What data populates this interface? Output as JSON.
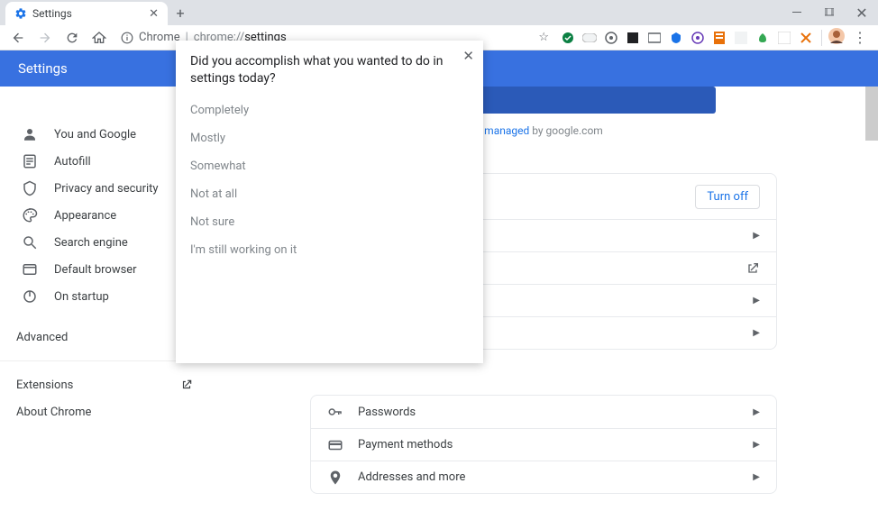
{
  "tab": {
    "title": "Settings"
  },
  "omnibox": {
    "origin": "Chrome",
    "prefix": "chrome://",
    "path": "settings"
  },
  "header": {
    "title": "Settings"
  },
  "sidebar": {
    "items": [
      {
        "label": "You and Google"
      },
      {
        "label": "Autofill"
      },
      {
        "label": "Privacy and security"
      },
      {
        "label": "Appearance"
      },
      {
        "label": "Search engine"
      },
      {
        "label": "Default browser"
      },
      {
        "label": "On startup"
      }
    ],
    "advanced": "Advanced",
    "extensions": "Extensions",
    "about": "About Chrome"
  },
  "managed": {
    "prefix": "",
    "link_word": "managed",
    "suffix": " by google.com"
  },
  "sync_card": {
    "turn_off": "Turn off",
    "rows": [
      "",
      "",
      "",
      ""
    ]
  },
  "autofill_card": {
    "rows": [
      {
        "label": "Passwords"
      },
      {
        "label": "Payment methods"
      },
      {
        "label": "Addresses and more"
      }
    ]
  },
  "survey": {
    "title": "Did you accomplish what you wanted to do in settings today?",
    "options": [
      "Completely",
      "Mostly",
      "Somewhat",
      "Not at all",
      "Not sure",
      "I'm still working on it"
    ]
  }
}
